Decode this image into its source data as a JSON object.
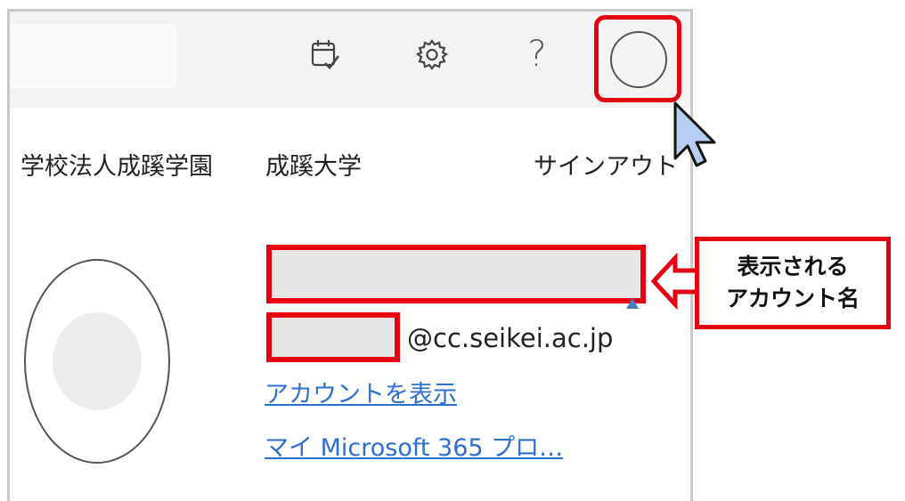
{
  "account_menu": {
    "org_name": "学校法人成蹊学園",
    "school_name": "成蹊大学",
    "signout_label": "サインアウト",
    "email_domain": "@cc.seikei.ac.jp",
    "view_account_label": "アカウントを表示",
    "my_profile_label": "マイ Microsoft 365 プロ…"
  },
  "toolbar": {
    "help_label": "?"
  },
  "annotation": {
    "line1": "表示される",
    "line2": "アカウント名"
  },
  "colors": {
    "highlight": "#e60012",
    "link": "#2b6fd0",
    "cursor": "#b8cdf2"
  },
  "icons": [
    "calendar-check-icon",
    "gear-icon",
    "help-icon",
    "avatar-icon",
    "mouse-pointer-icon"
  ]
}
